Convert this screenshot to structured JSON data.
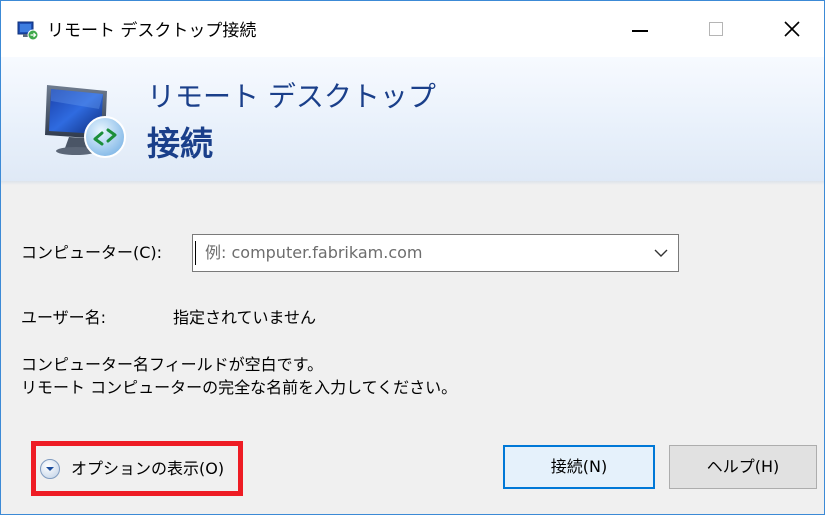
{
  "window": {
    "title": "リモート デスクトップ接続"
  },
  "banner": {
    "title_line1": "リモート デスクトップ",
    "title_line2": "接続"
  },
  "form": {
    "computer_label": "コンピューター(C):",
    "computer_value": "",
    "computer_placeholder": "例: computer.fabrikam.com",
    "user_label": "ユーザー名:",
    "user_value": "指定されていません",
    "message_line1": "コンピューター名フィールドが空白です。",
    "message_line2": "リモート コンピューターの完全な名前を入力してください。"
  },
  "footer": {
    "options_label": "オプションの表示(O)",
    "connect_label": "接続(N)",
    "help_label": "ヘルプ(H)"
  },
  "colors": {
    "highlight": "#ee1c24",
    "accent": "#0078d7",
    "banner_text": "#1a3f8a"
  },
  "icons": {
    "app": "remote-desktop-icon",
    "options": "expand-chevron-icon",
    "combo": "dropdown-arrow-icon"
  }
}
